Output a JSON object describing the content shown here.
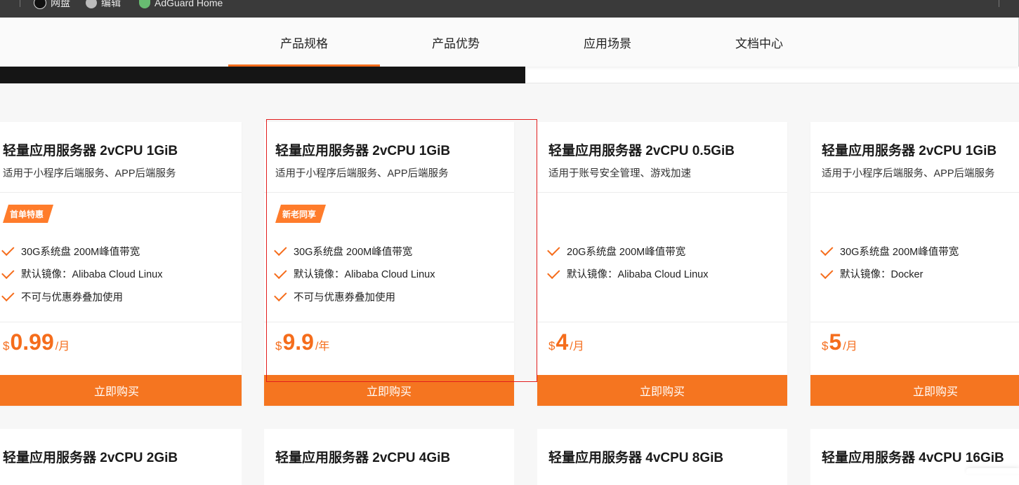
{
  "bookmarks": [
    {
      "label": "网盘",
      "icon": "cloud-icon"
    },
    {
      "label": "编辑",
      "icon": "globe-icon"
    },
    {
      "label": "AdGuard Home",
      "icon": "shield-icon"
    }
  ],
  "nav": {
    "tabs": [
      {
        "label": "产品规格",
        "active": true
      },
      {
        "label": "产品优势",
        "active": false
      },
      {
        "label": "应用场景",
        "active": false
      },
      {
        "label": "文档中心",
        "active": false
      }
    ]
  },
  "colors": {
    "accent": "#f56d1c",
    "highlight_box": "#e21d1d"
  },
  "cards": [
    {
      "title": "轻量应用服务器 2vCPU 1GiB",
      "subtitle": "适用于小程序后端服务、APP后端服务",
      "badge": "首单特惠",
      "features": [
        "30G系统盘 200M峰值带宽",
        "默认镜像：Alibaba Cloud Linux",
        "不可与优惠券叠加使用"
      ],
      "price": {
        "currency": "$",
        "amount": "0.99",
        "unit": "/月"
      },
      "buy_label": "立即购买"
    },
    {
      "title": "轻量应用服务器 2vCPU 1GiB",
      "subtitle": "适用于小程序后端服务、APP后端服务",
      "badge": "新老同享",
      "features": [
        "30G系统盘 200M峰值带宽",
        "默认镜像：Alibaba Cloud Linux",
        "不可与优惠券叠加使用"
      ],
      "price": {
        "currency": "$",
        "amount": "9.9",
        "unit": "/年"
      },
      "buy_label": "立即购买"
    },
    {
      "title": "轻量应用服务器 2vCPU 0.5GiB",
      "subtitle": "适用于账号安全管理、游戏加速",
      "badge": "",
      "features": [
        "20G系统盘 200M峰值带宽",
        "默认镜像：Alibaba Cloud Linux"
      ],
      "price": {
        "currency": "$",
        "amount": "4",
        "unit": "/月"
      },
      "buy_label": "立即购买"
    },
    {
      "title": "轻量应用服务器 2vCPU 1GiB",
      "subtitle": "适用于小程序后端服务、APP后端服务",
      "badge": "",
      "features": [
        "30G系统盘 200M峰值带宽",
        "默认镜像：Docker"
      ],
      "price": {
        "currency": "$",
        "amount": "5",
        "unit": "/月"
      },
      "buy_label": "立即购买"
    }
  ],
  "cards_row2": [
    {
      "title": "轻量应用服务器 2vCPU 2GiB"
    },
    {
      "title": "轻量应用服务器 2vCPU 4GiB"
    },
    {
      "title": "轻量应用服务器 4vCPU 8GiB"
    },
    {
      "title": "轻量应用服务器 4vCPU 16GiB"
    }
  ]
}
